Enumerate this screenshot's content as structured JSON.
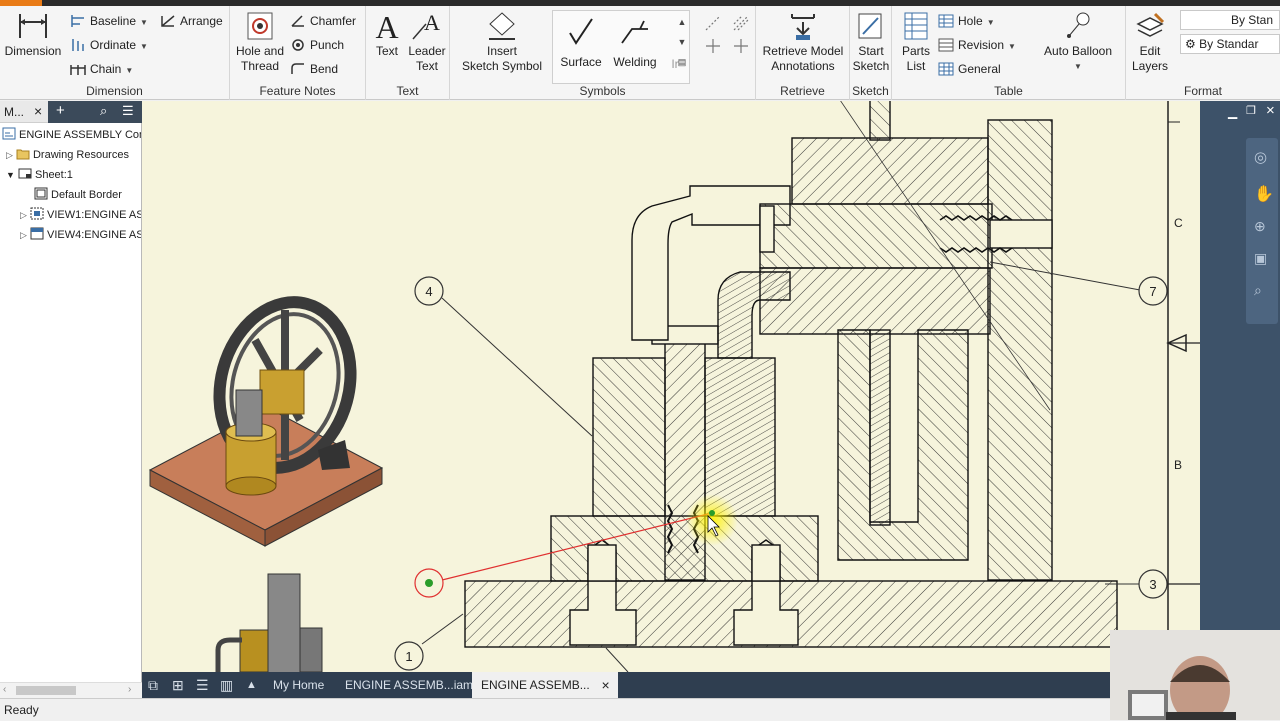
{
  "ribbon": {
    "dimension_panel": {
      "title": "Dimension",
      "dimension_btn": "Dimension",
      "baseline": "Baseline",
      "ordinate": "Ordinate",
      "chain": "Chain",
      "arrange": "Arrange"
    },
    "feature_notes_panel": {
      "title": "Feature Notes",
      "hole_and_thread_line1": "Hole and",
      "hole_and_thread_line2": "Thread",
      "chamfer": "Chamfer",
      "punch": "Punch",
      "bend": "Bend"
    },
    "text_panel": {
      "title": "Text",
      "text_btn": "Text",
      "leader_text_line1": "Leader",
      "leader_text_line2": "Text"
    },
    "symbols_panel": {
      "title": "Symbols",
      "insert_sketch_symbol_line1": "Insert",
      "insert_sketch_symbol_line2": "Sketch Symbol",
      "surface": "Surface",
      "welding": "Welding",
      "more": "Ir"
    },
    "retrieve_panel": {
      "title": "Retrieve",
      "retrieve_line1": "Retrieve Model",
      "retrieve_line2": "Annotations"
    },
    "sketch_panel": {
      "title": "Sketch",
      "start_sketch_line1": "Start",
      "start_sketch_line2": "Sketch"
    },
    "table_panel": {
      "title": "Table",
      "parts_list_line1": "Parts",
      "parts_list_line2": "List",
      "hole": "Hole",
      "revision": "Revision",
      "general": "General",
      "auto_balloon": "Auto Balloon"
    },
    "format_panel": {
      "title": "Format",
      "edit_layers_line1": "Edit",
      "edit_layers_line2": "Layers",
      "style_select": "By Stan",
      "standard_select": "By Standar"
    }
  },
  "browser": {
    "header_label": "M...",
    "items": [
      {
        "label": "ENGINE ASSEMBLY Comp",
        "icon": "drawing-icon"
      },
      {
        "label": "Drawing Resources",
        "icon": "folder-icon"
      },
      {
        "label": "Sheet:1",
        "icon": "sheet-icon"
      },
      {
        "label": "Default Border",
        "icon": "border-icon"
      },
      {
        "label": "VIEW1:ENGINE AS",
        "icon": "view-icon"
      },
      {
        "label": "VIEW4:ENGINE AS",
        "icon": "view-icon"
      }
    ]
  },
  "drawing": {
    "balloons": [
      "4",
      "7",
      "3",
      "1"
    ],
    "zone_labels": [
      "C",
      "B"
    ],
    "hatch_color": "#222222",
    "paper_color": "#f6f4dc",
    "leader_color": "#e03030"
  },
  "doctabs": {
    "home": "My Home",
    "tab1": "ENGINE ASSEMB...iam",
    "tab2": "ENGINE ASSEMB..."
  },
  "status": {
    "text": "Ready"
  }
}
